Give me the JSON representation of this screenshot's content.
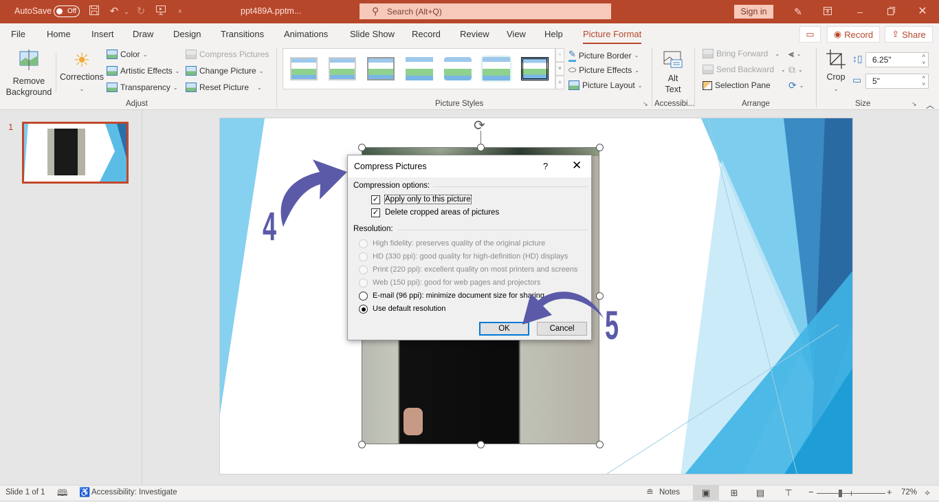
{
  "titlebar": {
    "autosave_label": "AutoSave",
    "autosave_state": "Off",
    "document_name": "ppt489A.pptm...",
    "search_placeholder": "Search (Alt+Q)",
    "sign_in": "Sign in",
    "icons": [
      "save-icon",
      "undo-icon",
      "redo-icon",
      "present-icon",
      "customize-qat-icon",
      "pen-icon",
      "ribbon-display-icon",
      "minimize-icon",
      "restore-icon",
      "close-icon"
    ]
  },
  "tabs": [
    {
      "label": "File"
    },
    {
      "label": "Home"
    },
    {
      "label": "Insert"
    },
    {
      "label": "Draw"
    },
    {
      "label": "Design"
    },
    {
      "label": "Transitions"
    },
    {
      "label": "Animations"
    },
    {
      "label": "Slide Show"
    },
    {
      "label": "Record"
    },
    {
      "label": "Review"
    },
    {
      "label": "View"
    },
    {
      "label": "Help"
    },
    {
      "label": "Picture Format",
      "active": true
    }
  ],
  "tab_actions": {
    "record": "Record",
    "share": "Share"
  },
  "ribbon": {
    "adjust": {
      "label": "Adjust",
      "remove_background": [
        "Remove",
        "Background"
      ],
      "corrections": "Corrections",
      "color": "Color",
      "artistic_effects": "Artistic Effects",
      "transparency": "Transparency",
      "compress_pictures": "Compress Pictures",
      "change_picture": "Change Picture",
      "reset_picture": "Reset Picture"
    },
    "picture_styles": {
      "label": "Picture Styles",
      "gallery_count": 7,
      "selected_index": 6,
      "picture_border": "Picture Border",
      "picture_effects": "Picture Effects",
      "picture_layout": "Picture Layout"
    },
    "accessibility": {
      "label": "Accessibi...",
      "alt_text": [
        "Alt",
        "Text"
      ]
    },
    "arrange": {
      "label": "Arrange",
      "bring_forward": "Bring Forward",
      "send_backward": "Send Backward",
      "selection_pane": "Selection Pane"
    },
    "size": {
      "label": "Size",
      "crop": "Crop",
      "height": "6.25\"",
      "width": "5\""
    }
  },
  "thumbnails": [
    {
      "number": "1"
    }
  ],
  "dialog": {
    "title": "Compress Pictures",
    "help": "?",
    "compression_label": "Compression options:",
    "checkboxes": [
      {
        "label": "Apply only to this picture",
        "checked": true
      },
      {
        "label": "Delete cropped areas of pictures",
        "checked": true
      }
    ],
    "resolution_label": "Resolution:",
    "radios": [
      {
        "label": "High fidelity: preserves quality of the original picture",
        "enabled": false,
        "selected": false
      },
      {
        "label": "HD (330 ppi): good quality for high-definition (HD) displays",
        "enabled": false,
        "selected": false
      },
      {
        "label": "Print (220 ppi): excellent quality on most printers and screens",
        "enabled": false,
        "selected": false
      },
      {
        "label": "Web (150 ppi): good for web pages and projectors",
        "enabled": false,
        "selected": false
      },
      {
        "label": "E-mail (96 ppi): minimize document size for sharing",
        "enabled": true,
        "selected": false
      },
      {
        "label": "Use default resolution",
        "enabled": true,
        "selected": true
      }
    ],
    "ok": "OK",
    "cancel": "Cancel"
  },
  "annotations": {
    "step_a": "4",
    "step_b": "5",
    "arrow_color": "#5b5aa8"
  },
  "statusbar": {
    "slide_info": "Slide 1 of 1",
    "accessibility": "Accessibility: Investigate",
    "notes": "Notes",
    "zoom": "72%",
    "zoom_percent": 72
  },
  "colors": {
    "accent": "#b7472a",
    "dialog_default_button": "#0078d7"
  }
}
